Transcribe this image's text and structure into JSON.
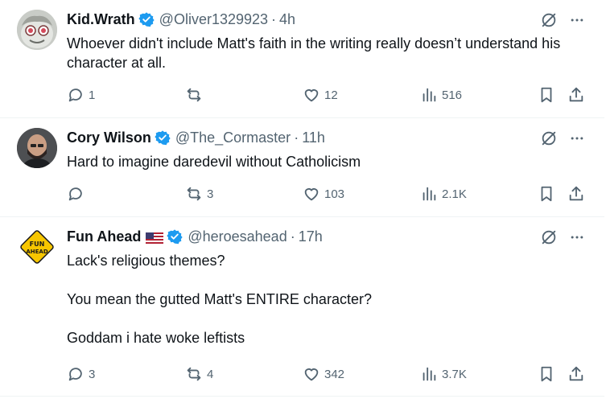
{
  "tweets": [
    {
      "name": "Kid.Wrath",
      "handle": "@Oliver1329923",
      "separator": "·",
      "time": "4h",
      "paragraphs": [
        "Whoever didn't include Matt's faith in the writing really doesn’t understand his character at all."
      ],
      "replies": "1",
      "reposts": "",
      "likes": "12",
      "views": "516"
    },
    {
      "name": "Cory Wilson",
      "handle": "@The_Cormaster",
      "separator": "·",
      "time": "11h",
      "paragraphs": [
        "Hard to imagine daredevil without Catholicism"
      ],
      "replies": "",
      "reposts": "3",
      "likes": "103",
      "views": "2.1K"
    },
    {
      "name": "Fun Ahead",
      "handle": "@heroesahead",
      "separator": "·",
      "time": "17h",
      "avatar_text": [
        "FUN",
        "AHEAD"
      ],
      "paragraphs": [
        "Lack's religious themes?",
        "You mean the gutted Matt's ENTIRE character?",
        "Goddam i hate woke leftists"
      ],
      "replies": "3",
      "reposts": "4",
      "likes": "342",
      "views": "3.7K"
    }
  ],
  "icons": {
    "verified": "verified-badge-icon",
    "grok": "grok-icon",
    "more": "more-icon",
    "reply": "reply-icon",
    "repost": "repost-icon",
    "like": "like-icon",
    "views": "views-icon",
    "bookmark": "bookmark-icon",
    "share": "share-icon"
  },
  "colors": {
    "text": "#0f1419",
    "secondary": "#536471",
    "verified": "#1d9bf0",
    "divider": "#eff3f4",
    "fun_ahead_sign": "#f7c600"
  }
}
